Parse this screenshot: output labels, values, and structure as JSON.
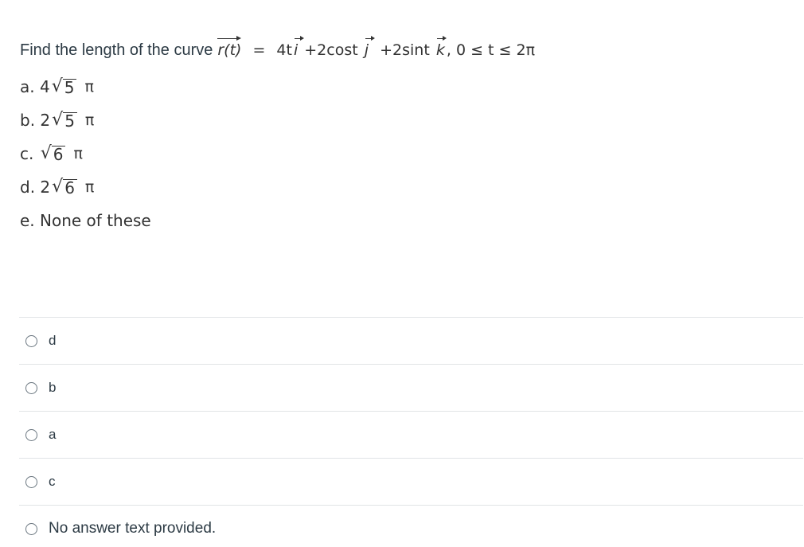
{
  "question": {
    "prompt": "Find the length of the curve",
    "vector_fn": "r(t)",
    "equals": "=",
    "term1_coef": "4t",
    "unit_i": "i",
    "plus1": "+2cost",
    "unit_j": "j",
    "plus2": "+2sint",
    "unit_k": "k",
    "range": ", 0 ≤ t ≤ 2π",
    "choices": [
      {
        "letter": "a.",
        "coef": "4",
        "radicand": "5",
        "pi": "π"
      },
      {
        "letter": "b.",
        "coef": "2",
        "radicand": "5",
        "pi": "π"
      },
      {
        "letter": "c.",
        "coef": "",
        "radicand": "6",
        "pi": "π"
      },
      {
        "letter": "d.",
        "coef": "2",
        "radicand": "6",
        "pi": "π"
      }
    ],
    "choice_e": "e. None of these"
  },
  "answers": [
    {
      "label": "d"
    },
    {
      "label": "b"
    },
    {
      "label": "a"
    },
    {
      "label": "c"
    },
    {
      "label": "No answer text provided."
    }
  ]
}
